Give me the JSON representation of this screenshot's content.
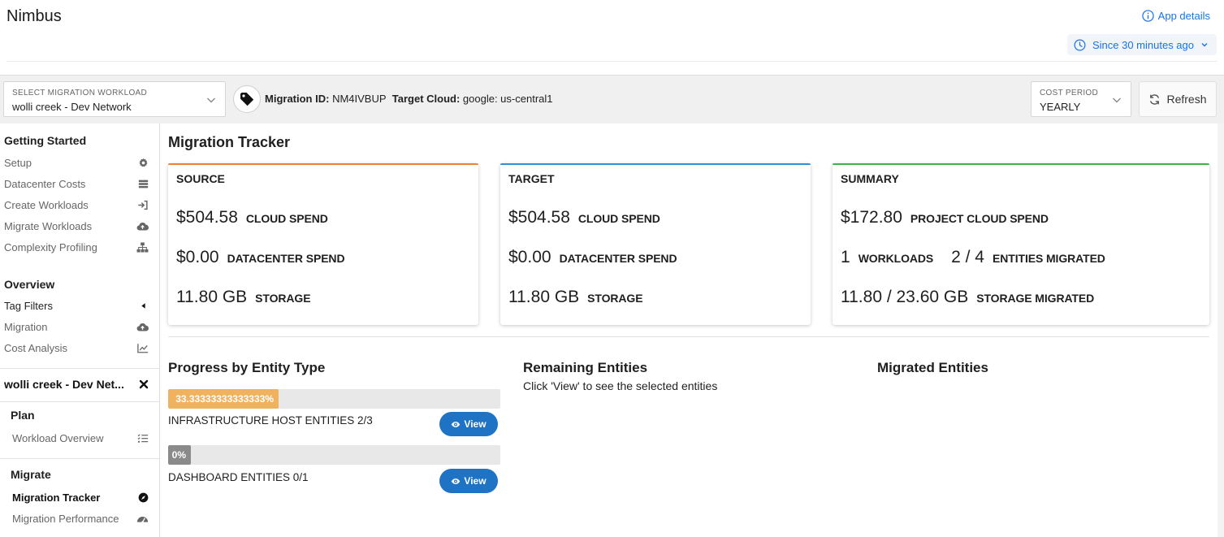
{
  "header": {
    "app_title": "Nimbus",
    "app_details_label": "App details",
    "time_range_label": "Since 30 minutes ago"
  },
  "toolbar": {
    "workload_select": {
      "label": "SELECT MIGRATION WORKLOAD",
      "value": "wolli creek - Dev Network"
    },
    "migration_id_label": "Migration ID:",
    "migration_id": "NM4IVBUP",
    "target_cloud_label": "Target Cloud:",
    "target_cloud": "google: us-central1",
    "cost_period": {
      "label": "COST PERIOD",
      "value": "YEARLY"
    },
    "refresh_label": "Refresh"
  },
  "sidebar": {
    "getting_started": {
      "heading": "Getting Started",
      "items": [
        {
          "label": "Setup",
          "icon": "gear-icon"
        },
        {
          "label": "Datacenter Costs",
          "icon": "server-icon"
        },
        {
          "label": "Create Workloads",
          "icon": "sign-in-icon"
        },
        {
          "label": "Migrate Workloads",
          "icon": "cloud-upload-icon"
        },
        {
          "label": "Complexity Profiling",
          "icon": "sitemap-icon"
        }
      ]
    },
    "overview": {
      "heading": "Overview",
      "items": [
        {
          "label": "Tag Filters",
          "icon": "caret-left-icon"
        },
        {
          "label": "Migration",
          "icon": "cloud-upload-icon"
        },
        {
          "label": "Cost Analysis",
          "icon": "line-chart-icon"
        }
      ]
    },
    "workload": {
      "name": "wolli creek - Dev Net...",
      "icon": "close-icon"
    },
    "plan": {
      "heading": "Plan",
      "items": [
        {
          "label": "Workload Overview",
          "icon": "list-icon"
        }
      ]
    },
    "migrate": {
      "heading": "Migrate",
      "items": [
        {
          "label": "Migration Tracker",
          "icon": "compass-icon",
          "active": true
        },
        {
          "label": "Migration Performance",
          "icon": "dashboard-icon"
        }
      ]
    }
  },
  "main": {
    "title": "Migration Tracker",
    "cards": {
      "source": {
        "title": "SOURCE",
        "cloud_spend": "$504.58",
        "cloud_spend_label": "CLOUD SPEND",
        "datacenter_spend": "$0.00",
        "datacenter_spend_label": "DATACENTER SPEND",
        "storage": "11.80 GB",
        "storage_label": "STORAGE"
      },
      "target": {
        "title": "TARGET",
        "cloud_spend": "$504.58",
        "cloud_spend_label": "CLOUD SPEND",
        "datacenter_spend": "$0.00",
        "datacenter_spend_label": "DATACENTER SPEND",
        "storage": "11.80 GB",
        "storage_label": "STORAGE"
      },
      "summary": {
        "title": "SUMMARY",
        "project_cloud_spend": "$172.80",
        "project_cloud_spend_label": "PROJECT CLOUD SPEND",
        "workloads": "1",
        "workloads_label": "WORKLOADS",
        "entities_migrated": "2 / 4",
        "entities_migrated_label": "ENTITIES MIGRATED",
        "storage_migrated": "11.80 / 23.60 GB",
        "storage_migrated_label": "STORAGE MIGRATED"
      }
    },
    "progress_title": "Progress by Entity Type",
    "progress": [
      {
        "percent_text": "33.33333333333333%",
        "fraction": 0.333,
        "label": "INFRASTRUCTURE HOST ENTITIES 2/3",
        "view_label": "View",
        "color": "#f0b25f"
      },
      {
        "percent_text": "0%",
        "fraction": 0,
        "label": "DASHBOARD ENTITIES 0/1",
        "view_label": "View",
        "color": "#8a8a8a"
      }
    ],
    "remaining_title": "Remaining Entities",
    "remaining_hint": "Click 'View' to see the selected entities",
    "migrated_title": "Migrated Entities"
  },
  "colors": {
    "accent": "#1a73e8",
    "view_button": "#1e73c5",
    "source_bar": "#e8833a",
    "target_bar": "#2f8fd8",
    "summary_bar": "#3bb54a"
  }
}
